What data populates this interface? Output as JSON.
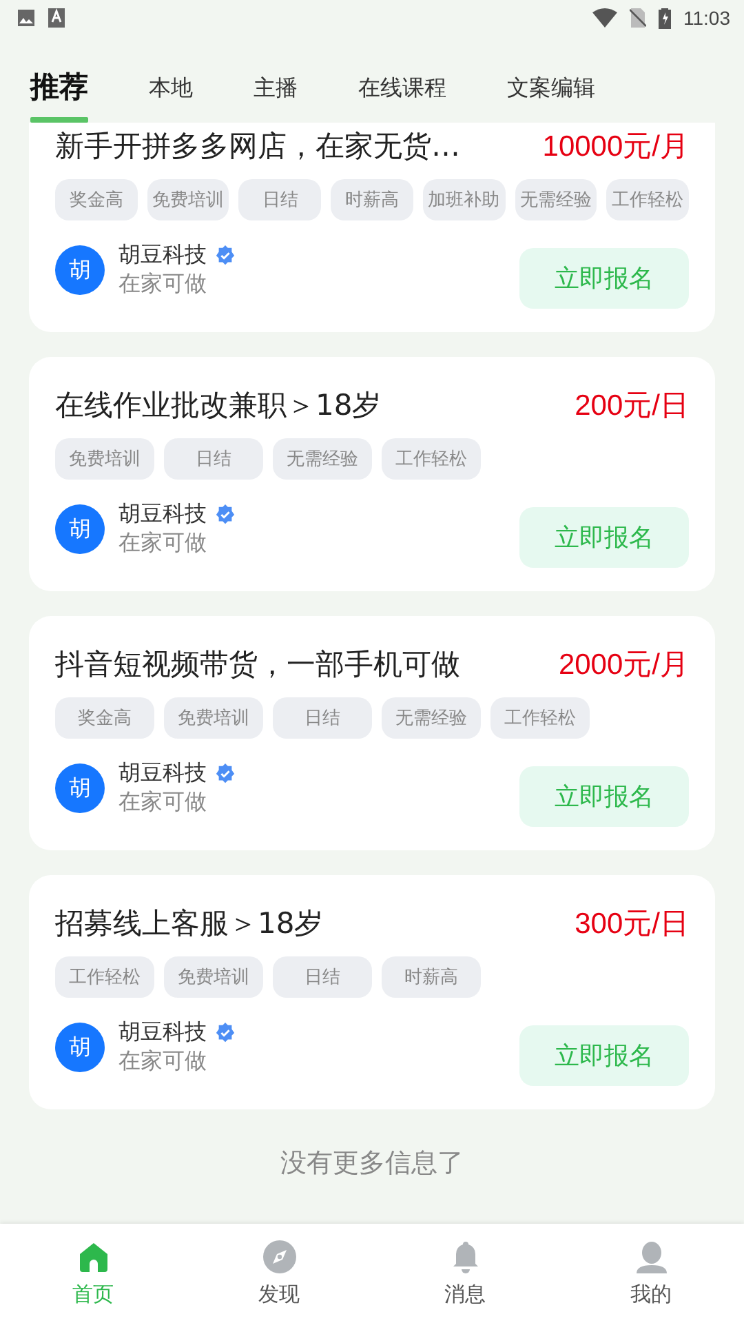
{
  "status_bar": {
    "time": "11:03"
  },
  "tabs": [
    {
      "label": "推荐",
      "selected": true
    },
    {
      "label": "本地",
      "selected": false
    },
    {
      "label": "主播",
      "selected": false
    },
    {
      "label": "在线课程",
      "selected": false
    },
    {
      "label": "文案编辑",
      "selected": false
    }
  ],
  "jobs": [
    {
      "title": "新手开拼多多网店，在家无货…",
      "salary": "10000元/月",
      "tags": [
        "奖金高",
        "免费培训",
        "日结",
        "时薪高",
        "加班补助",
        "无需经验",
        "工作轻松"
      ],
      "avatar": "胡",
      "company": "胡豆科技",
      "verified": true,
      "location": "在家可做",
      "button": "立即报名"
    },
    {
      "title": "在线作业批改兼职＞18岁",
      "salary": "200元/日",
      "tags": [
        "免费培训",
        "日结",
        "无需经验",
        "工作轻松"
      ],
      "avatar": "胡",
      "company": "胡豆科技",
      "verified": true,
      "location": "在家可做",
      "button": "立即报名"
    },
    {
      "title": "抖音短视频带货，一部手机可做",
      "salary": "2000元/月",
      "tags": [
        "奖金高",
        "免费培训",
        "日结",
        "无需经验",
        "工作轻松"
      ],
      "avatar": "胡",
      "company": "胡豆科技",
      "verified": true,
      "location": "在家可做",
      "button": "立即报名"
    },
    {
      "title": "招募线上客服＞18岁",
      "salary": "300元/日",
      "tags": [
        "工作轻松",
        "免费培训",
        "日结",
        "时薪高"
      ],
      "avatar": "胡",
      "company": "胡豆科技",
      "verified": true,
      "location": "在家可做",
      "button": "立即报名"
    }
  ],
  "footer_note": "没有更多信息了",
  "bottom_nav": [
    {
      "label": "首页",
      "kind": "home",
      "selected": true
    },
    {
      "label": "发现",
      "kind": "discover",
      "selected": false
    },
    {
      "label": "消息",
      "kind": "messages",
      "selected": false
    },
    {
      "label": "我的",
      "kind": "profile",
      "selected": false
    }
  ]
}
